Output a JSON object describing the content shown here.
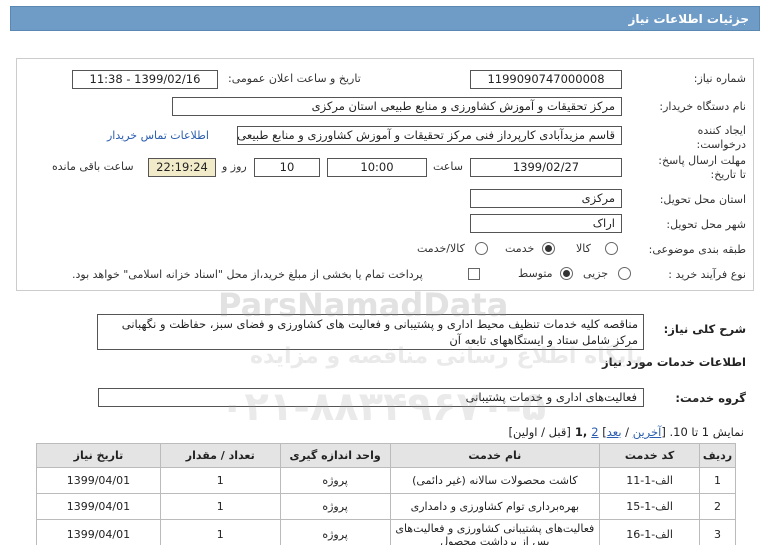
{
  "header": {
    "title": "جزئیات اطلاعات نیاز"
  },
  "fields": {
    "need_number_label": "شماره نیاز:",
    "need_number": "1199090747000008",
    "announce_label": "تاریخ و ساعت اعلان عمومی:",
    "announce_value": "1399/02/16 - 11:38",
    "buyer_label": "نام دستگاه خریدار:",
    "buyer_value": "مرکز تحقیقات و آموزش کشاورزی و منابع طبیعی استان مرکزی",
    "creator_label_1": "ایجاد کننده",
    "creator_label_2": "درخواست:",
    "creator_value": "قاسم مزیدآبادی کارپرداز فنی مرکز تحقیقات و آموزش کشاورزی و منابع طبیعی استان مرکزی",
    "contact_link": "اطلاعات تماس خریدار",
    "deadline_label_1": "مهلت ارسال پاسخ:",
    "deadline_label_2": "تا تاریخ:",
    "deadline_date": "1399/02/27",
    "time_label": "ساعت",
    "deadline_time": "10:00",
    "days_value": "10",
    "days_label": "روز و",
    "remaining_time": "22:19:24",
    "remaining_label": "ساعت باقی مانده",
    "province_label": "استان محل تحویل:",
    "province_value": "مرکزی",
    "city_label": "شهر محل تحویل:",
    "city_value": "اراک",
    "category_label": "طبقه بندی موضوعی:",
    "category_options": [
      "کالا",
      "خدمت",
      "کالا/خدمت"
    ],
    "category_selected": "خدمت",
    "process_label": "نوع فرآیند خرید :",
    "process_options": [
      "جزیی",
      "متوسط"
    ],
    "process_selected": "متوسط",
    "payment_note": "پرداخت تمام یا بخشی از مبلغ خرید،از محل \"اسناد خزانه اسلامی\" خواهد بود."
  },
  "description": {
    "label": "شرح کلی نیاز:",
    "text": "مناقصه کلیه خدمات تنظیف محیط اداری و پشتیبانی و فعالیت های کشاورزی و فضای سبز، حفاظت و نگهبانی مرکز  شامل ستاد و ایستگاههای تابعه آن"
  },
  "services": {
    "title": "اطلاعات خدمات مورد نیاز",
    "group_label": "گروه خدمت:",
    "group_value": "فعالیت‌های اداری و خدمات پشتیبانی"
  },
  "pager": {
    "text_start": "نمایش 1 تا 10. [",
    "last": "آخرین",
    "sep1": " / ",
    "next": "بعد",
    "text_mid": "] ",
    "page2": "2",
    "page1": " ,1 ",
    "text_end": "[قبل / اولین]"
  },
  "table": {
    "headers": [
      "ردیف",
      "کد خدمت",
      "نام خدمت",
      "واحد اندازه گیری",
      "تعداد / مقدار",
      "تاریخ نیاز"
    ],
    "rows": [
      [
        "1",
        "الف-1-11",
        "کاشت محصولات سالانه (غیر دائمی)",
        "پروژه",
        "1",
        "1399/04/01"
      ],
      [
        "2",
        "الف-1-15",
        "بهره‌برداری توام کشاورزی و دامداری",
        "پروژه",
        "1",
        "1399/04/01"
      ],
      [
        "3",
        "الف-1-16",
        "فعالیت‌های پشتیبانی کشاورزی و فعالیت‌های پس از برداشت محصول",
        "پروژه",
        "1",
        "1399/04/01"
      ]
    ]
  },
  "watermark": {
    "brand": "ParsNamadData",
    "line1": "پایگاه اطلاع رسانی مناقصه و مزایده",
    "phone": "۰۲۱-۸۸۳۴۹۶۷۰-۵"
  },
  "colors": {
    "header_bg": "#6f9cc7",
    "remaining_bg": "#f1ebc9",
    "link": "#2a5db0"
  }
}
